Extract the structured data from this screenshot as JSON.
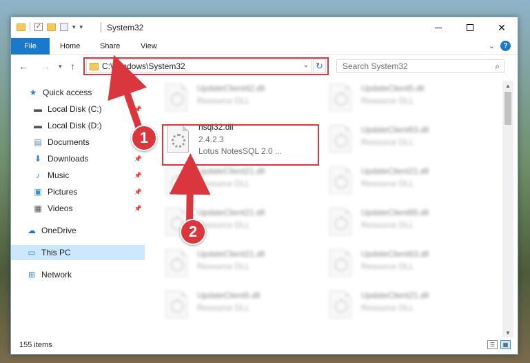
{
  "window": {
    "title": "System32"
  },
  "ribbon": {
    "tabs": [
      "File",
      "Home",
      "Share",
      "View"
    ],
    "help_label": "?"
  },
  "navigation": {
    "address": "C:\\Windows\\System32",
    "search_placeholder": "Search System32"
  },
  "sidebar": {
    "items": [
      {
        "label": "Quick access",
        "icon": "star-icon",
        "pinned": false
      },
      {
        "label": "Local Disk (C:)",
        "icon": "drive-icon",
        "pinned": true
      },
      {
        "label": "Local Disk (D:)",
        "icon": "drive-icon",
        "pinned": true
      },
      {
        "label": "Documents",
        "icon": "document-icon",
        "pinned": true
      },
      {
        "label": "Downloads",
        "icon": "download-icon",
        "pinned": true
      },
      {
        "label": "Music",
        "icon": "music-icon",
        "pinned": true
      },
      {
        "label": "Pictures",
        "icon": "pictures-icon",
        "pinned": true
      },
      {
        "label": "Videos",
        "icon": "videos-icon",
        "pinned": true
      },
      {
        "label": "OneDrive",
        "icon": "cloud-icon",
        "pinned": false
      },
      {
        "label": "This PC",
        "icon": "computer-icon",
        "pinned": false,
        "selected": true
      },
      {
        "label": "Network",
        "icon": "network-icon",
        "pinned": false
      }
    ]
  },
  "files": {
    "highlighted": {
      "name": "nsql32.dll",
      "version": "2.4.2.3",
      "description": "Lotus NotesSQL 2.0 ..."
    },
    "left_column": [
      {
        "name": "UpdateClient42.dll",
        "type": "Resource DLL"
      },
      {
        "name": "UpdateClient21.dll",
        "type": "Resource DLL"
      },
      {
        "name": "UpdateClient21.dll",
        "type": "Resource DLL"
      },
      {
        "name": "UpdateClient21.dll",
        "type": "Resource DLL"
      },
      {
        "name": "UpdateClient5.dll",
        "type": "Resource DLL"
      }
    ],
    "right_column": [
      {
        "name": "UpdateClient5.dll",
        "type": "Resource DLL"
      },
      {
        "name": "UpdateClient63.dll",
        "type": "Resource DLL"
      },
      {
        "name": "UpdateClient21.dll",
        "type": "Resource DLL"
      },
      {
        "name": "UpdateClient65.dll",
        "type": "Resource DLL"
      },
      {
        "name": "UpdateClient63.dll",
        "type": "Resource DLL"
      },
      {
        "name": "UpdateClient21.dll",
        "type": "Resource DLL"
      }
    ]
  },
  "status": {
    "item_count": "155 items"
  },
  "annotations": {
    "step1": "1",
    "step2": "2",
    "color": "#d9363e"
  }
}
